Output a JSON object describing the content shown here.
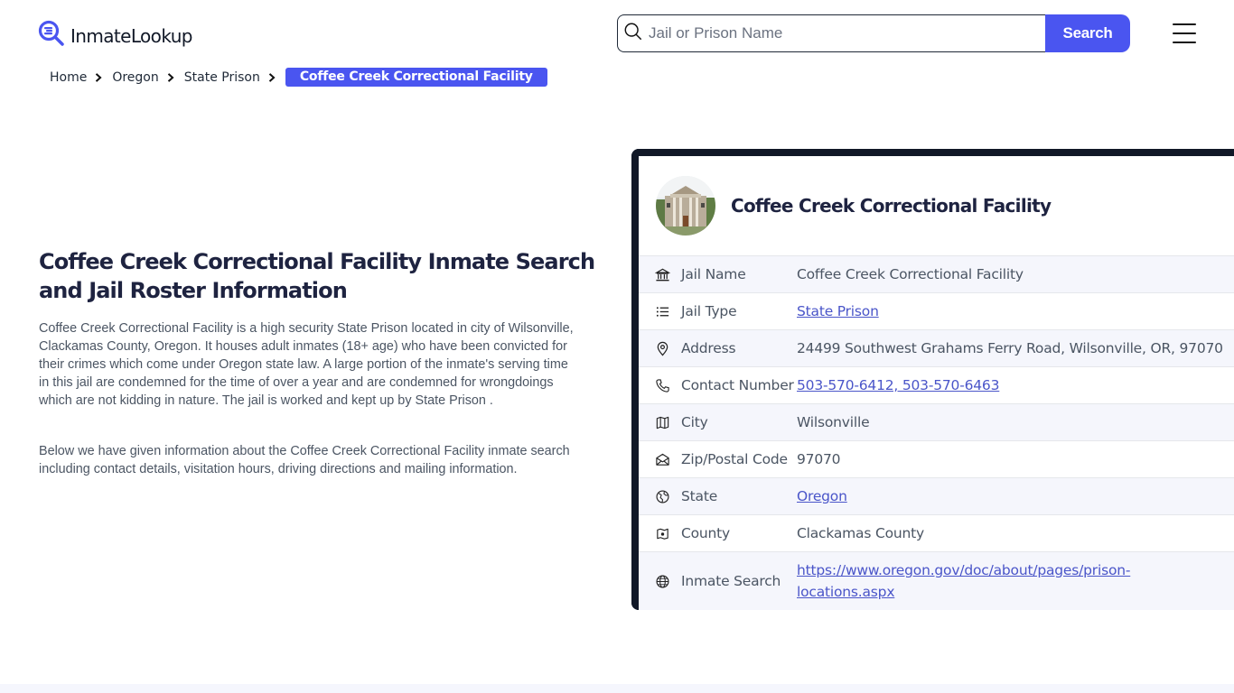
{
  "header": {
    "logo_text": "InmateLookup",
    "search": {
      "placeholder": "Jail or Prison Name",
      "value": "",
      "button_label": "Search"
    },
    "menu_icon": "hamburger-menu-icon"
  },
  "breadcrumb": {
    "items": [
      "Home",
      "Oregon",
      "State Prison"
    ],
    "current": "Coffee Creek Correctional Facility"
  },
  "main": {
    "title": "Coffee Creek Correctional Facility Inmate Search and Jail Roster Information",
    "paragraphs": [
      "Coffee Creek Correctional Facility is a high security State Prison located in city of Wilsonville, Clackamas County, Oregon. It houses adult inmates (18+ age) who have been convicted for their crimes which come under Oregon state law. A large portion of the inmate's serving time in this jail are condemned for the time of over a year and are condemned for wrongdoings which are not kidding in nature. The jail is worked and kept up by State Prison .",
      "Below we have given information about the Coffee Creek Correctional Facility inmate search including contact details, visitation hours, driving directions and mailing information."
    ]
  },
  "card": {
    "title": "Coffee Creek Correctional Facility",
    "rows": [
      {
        "icon": "building-columns-icon",
        "label": "Jail Name",
        "value": "Coffee Creek Correctional Facility",
        "link": false
      },
      {
        "icon": "list-icon",
        "label": "Jail Type",
        "value": "State Prison",
        "link": true
      },
      {
        "icon": "map-pin-icon",
        "label": "Address",
        "value": "24499 Southwest Grahams Ferry Road, Wilsonville, OR, 97070",
        "link": false
      },
      {
        "icon": "phone-icon",
        "label": "Contact Number",
        "value": "503-570-6412, 503-570-6463",
        "link": true
      },
      {
        "icon": "map-icon",
        "label": "City",
        "value": "Wilsonville",
        "link": false
      },
      {
        "icon": "mail-open-icon",
        "label": "Zip/Postal Code",
        "value": "97070",
        "link": false
      },
      {
        "icon": "globe-region-icon",
        "label": "State",
        "value": "Oregon",
        "link": true
      },
      {
        "icon": "county-map-icon",
        "label": "County",
        "value": "Clackamas County",
        "link": false
      },
      {
        "icon": "world-icon",
        "label": "Inmate Search",
        "value": "https://www.oregon.gov/doc/about/pages/prison-locations.aspx",
        "link": true
      }
    ]
  },
  "colors": {
    "accent": "#4a55f0",
    "dark": "#111827",
    "link": "#4a55c9",
    "row_alt": "#f5f6fc"
  }
}
